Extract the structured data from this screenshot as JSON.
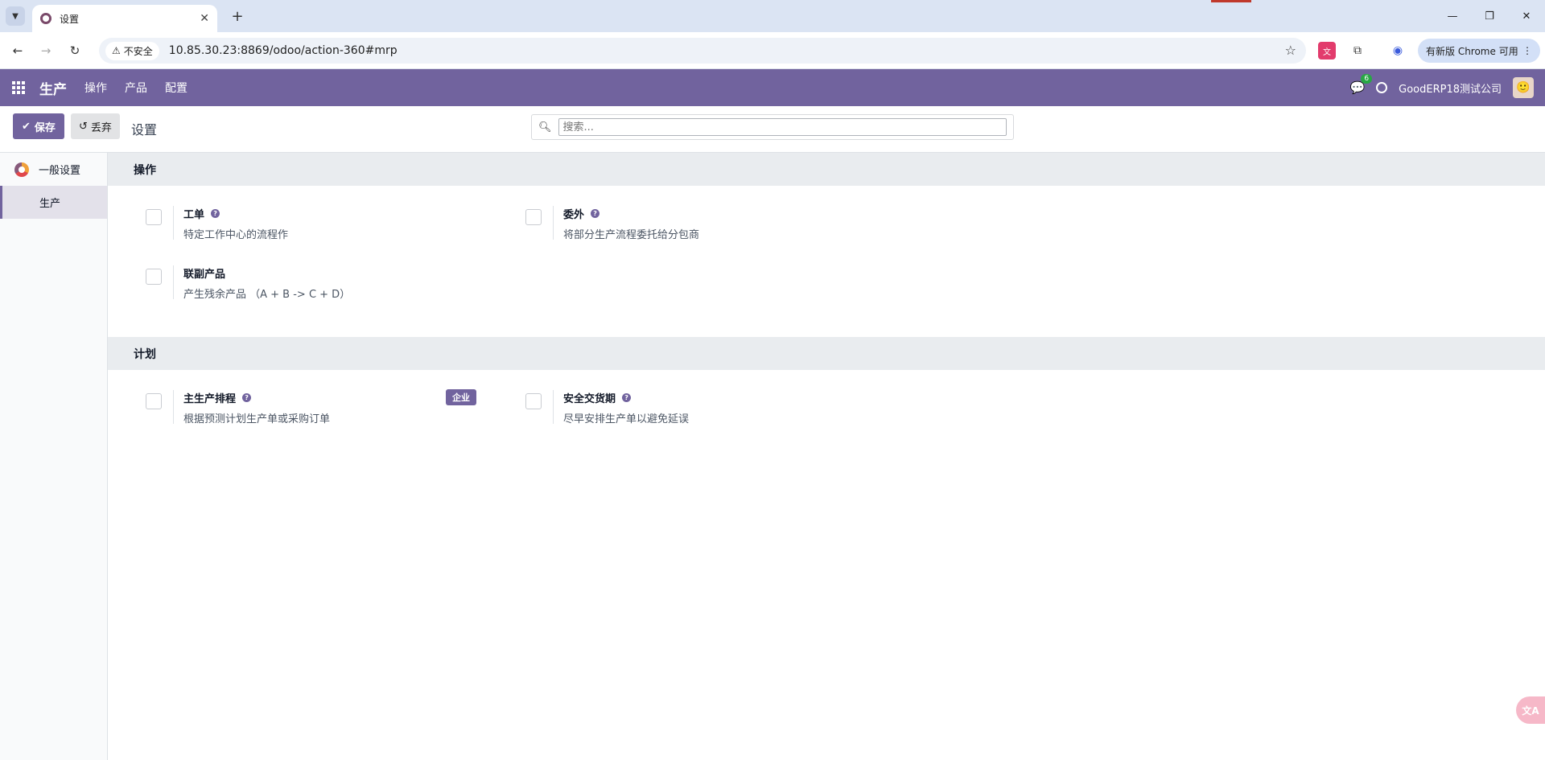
{
  "browser": {
    "tab_title": "设置",
    "security_label": "不安全",
    "url": "10.85.30.23:8869/odoo/action-360#mrp",
    "update_label": "有新版 Chrome 可用"
  },
  "navbar": {
    "app_name": "生产",
    "menus": [
      "操作",
      "产品",
      "配置"
    ],
    "chat_count": "6",
    "company": "GoodERP18测试公司"
  },
  "control_panel": {
    "save_label": "保存",
    "discard_label": "丢弃",
    "title": "设置",
    "search_placeholder": "搜索..."
  },
  "sidebar": {
    "items": [
      {
        "label": "一般设置"
      },
      {
        "label": "生产"
      }
    ]
  },
  "sections": [
    {
      "title": "操作",
      "settings": [
        {
          "title": "工单",
          "desc": "特定工作中心的流程作",
          "checked": false
        },
        {
          "title": "委外",
          "desc": "将部分生产流程委托给分包商",
          "checked": false
        },
        {
          "title": "联副产品",
          "desc": "产生残余产品 （A + B -> C + D）",
          "checked": false
        }
      ]
    },
    {
      "title": "计划",
      "settings": [
        {
          "title": "主生产排程",
          "desc": "根据预测计划生产单或采购订单",
          "badge": "企业",
          "checked": false
        },
        {
          "title": "安全交货期",
          "desc": "尽早安排生产单以避免延误",
          "checked": false
        }
      ]
    }
  ],
  "colors": {
    "brand": "#71639e",
    "section_bg": "#e9ecef"
  }
}
